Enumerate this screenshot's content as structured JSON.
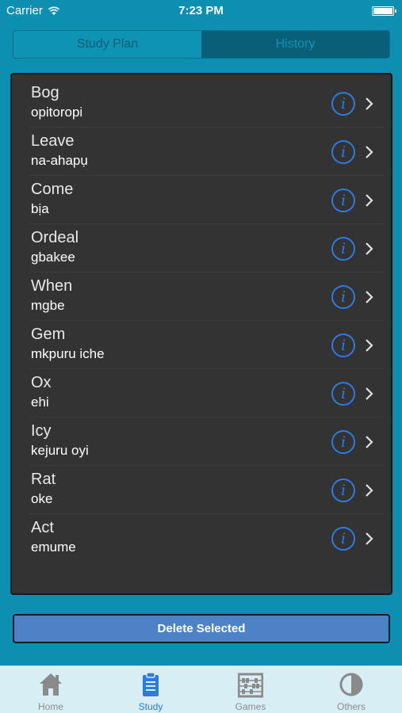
{
  "status_bar": {
    "carrier": "Carrier",
    "time": "7:23 PM"
  },
  "segmented": {
    "items": [
      {
        "label": "Study Plan",
        "selected": false
      },
      {
        "label": "History",
        "selected": true
      }
    ]
  },
  "list": {
    "items": [
      {
        "word": "Bog",
        "translation": "opitoropi"
      },
      {
        "word": "Leave",
        "translation": "na-ahapụ"
      },
      {
        "word": "Come",
        "translation": "bịa"
      },
      {
        "word": "Ordeal",
        "translation": "gbakee"
      },
      {
        "word": "When",
        "translation": "mgbe"
      },
      {
        "word": "Gem",
        "translation": "mkpuru iche"
      },
      {
        "word": "Ox",
        "translation": "ehi"
      },
      {
        "word": "Icy",
        "translation": "kejuru oyi"
      },
      {
        "word": "Rat",
        "translation": "oke"
      },
      {
        "word": "Act",
        "translation": "emume"
      }
    ]
  },
  "actions": {
    "delete_label": "Delete Selected"
  },
  "tab_bar": {
    "items": [
      {
        "label": "Home",
        "icon": "home-icon"
      },
      {
        "label": "Study",
        "icon": "clipboard-icon",
        "selected": true
      },
      {
        "label": "Games",
        "icon": "abacus-icon"
      },
      {
        "label": "Others",
        "icon": "pie-icon"
      }
    ]
  },
  "colors": {
    "background": "#0c8fb0",
    "panel": "#333333",
    "accent": "#2d7be0",
    "button": "#4d83c6"
  }
}
